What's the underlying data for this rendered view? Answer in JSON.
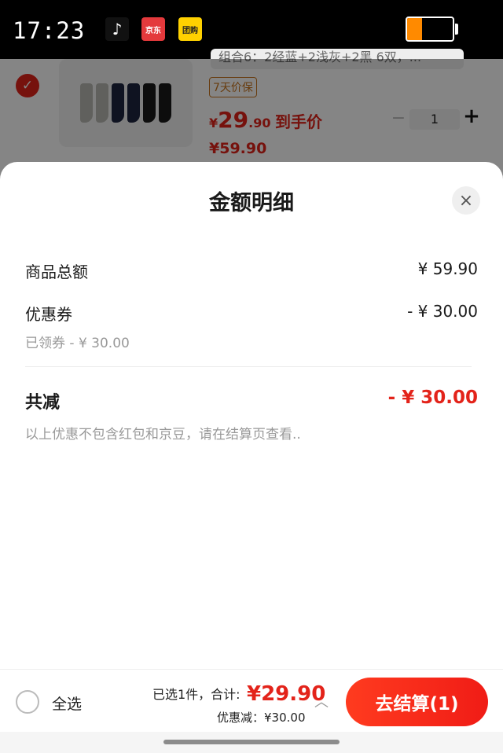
{
  "status_bar": {
    "time": "17:23",
    "apps": [
      {
        "name": "tiktok-icon",
        "glyph": "♪"
      },
      {
        "name": "jd-icon",
        "glyph": "京东"
      },
      {
        "name": "meituan-icon",
        "glyph": "团购"
      }
    ],
    "battery_level": 0.32
  },
  "cart_item": {
    "spec": "组合6：2经蓝+2浅灰+2黑 6双，...",
    "tag": "7天价保",
    "price_symbol": "¥",
    "price_int": "29",
    "price_dec": ".90",
    "price_suffix": "到手价",
    "original_price": "¥59.90",
    "quantity": "1",
    "qty_minus": "−",
    "qty_plus": "+"
  },
  "sheet": {
    "title": "金额明细",
    "close": "×",
    "rows": [
      {
        "label": "商品总额",
        "value": "¥ 59.90"
      },
      {
        "label": "优惠券",
        "value": "- ¥ 30.00",
        "sub": "已领券 - ¥ 30.00"
      }
    ],
    "total_label": "共减",
    "total_value": "- ¥ 30.00",
    "note": "以上优惠不包含红包和京豆，请在结算页查看.."
  },
  "bottom_bar": {
    "select_all": "全选",
    "selected_text": "已选1件，合计:",
    "total": "¥29.90",
    "discount": "优惠减：¥30.00",
    "checkout": "去结算(1)"
  },
  "colors": {
    "accent": "#e3231a",
    "tag": "#c8741c"
  }
}
